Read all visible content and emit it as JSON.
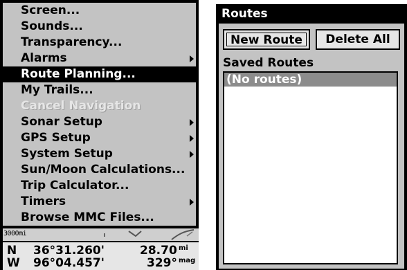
{
  "menu": {
    "items": [
      {
        "label": "Screen...",
        "submenu": false,
        "selected": false,
        "disabled": false
      },
      {
        "label": "Sounds...",
        "submenu": false,
        "selected": false,
        "disabled": false
      },
      {
        "label": "Transparency...",
        "submenu": false,
        "selected": false,
        "disabled": false
      },
      {
        "label": "Alarms",
        "submenu": true,
        "selected": false,
        "disabled": false
      },
      {
        "label": "Route Planning...",
        "submenu": false,
        "selected": true,
        "disabled": false
      },
      {
        "label": "My Trails...",
        "submenu": false,
        "selected": false,
        "disabled": false
      },
      {
        "label": "Cancel Navigation",
        "submenu": false,
        "selected": false,
        "disabled": true
      },
      {
        "label": "Sonar Setup",
        "submenu": true,
        "selected": false,
        "disabled": false
      },
      {
        "label": "GPS Setup",
        "submenu": true,
        "selected": false,
        "disabled": false
      },
      {
        "label": "System Setup",
        "submenu": true,
        "selected": false,
        "disabled": false
      },
      {
        "label": "Sun/Moon Calculations...",
        "submenu": false,
        "selected": false,
        "disabled": false
      },
      {
        "label": "Trip Calculator...",
        "submenu": false,
        "selected": false,
        "disabled": false
      },
      {
        "label": "Timers",
        "submenu": true,
        "selected": false,
        "disabled": false
      },
      {
        "label": "Browse MMC Files...",
        "submenu": false,
        "selected": false,
        "disabled": false
      }
    ]
  },
  "map": {
    "scale": "3000mi"
  },
  "status": {
    "lat_dir": "N",
    "lat_value": "36°31.260'",
    "lon_dir": "W",
    "lon_value": "96°04.457'",
    "distance_value": "28.70",
    "distance_unit": "mi",
    "heading_value": "329°",
    "heading_unit": "mag"
  },
  "routes": {
    "title": "Routes",
    "new_route_label": "New Route",
    "delete_all_label": "Delete All",
    "saved_label": "Saved Routes",
    "list": [
      "(No routes)"
    ]
  }
}
